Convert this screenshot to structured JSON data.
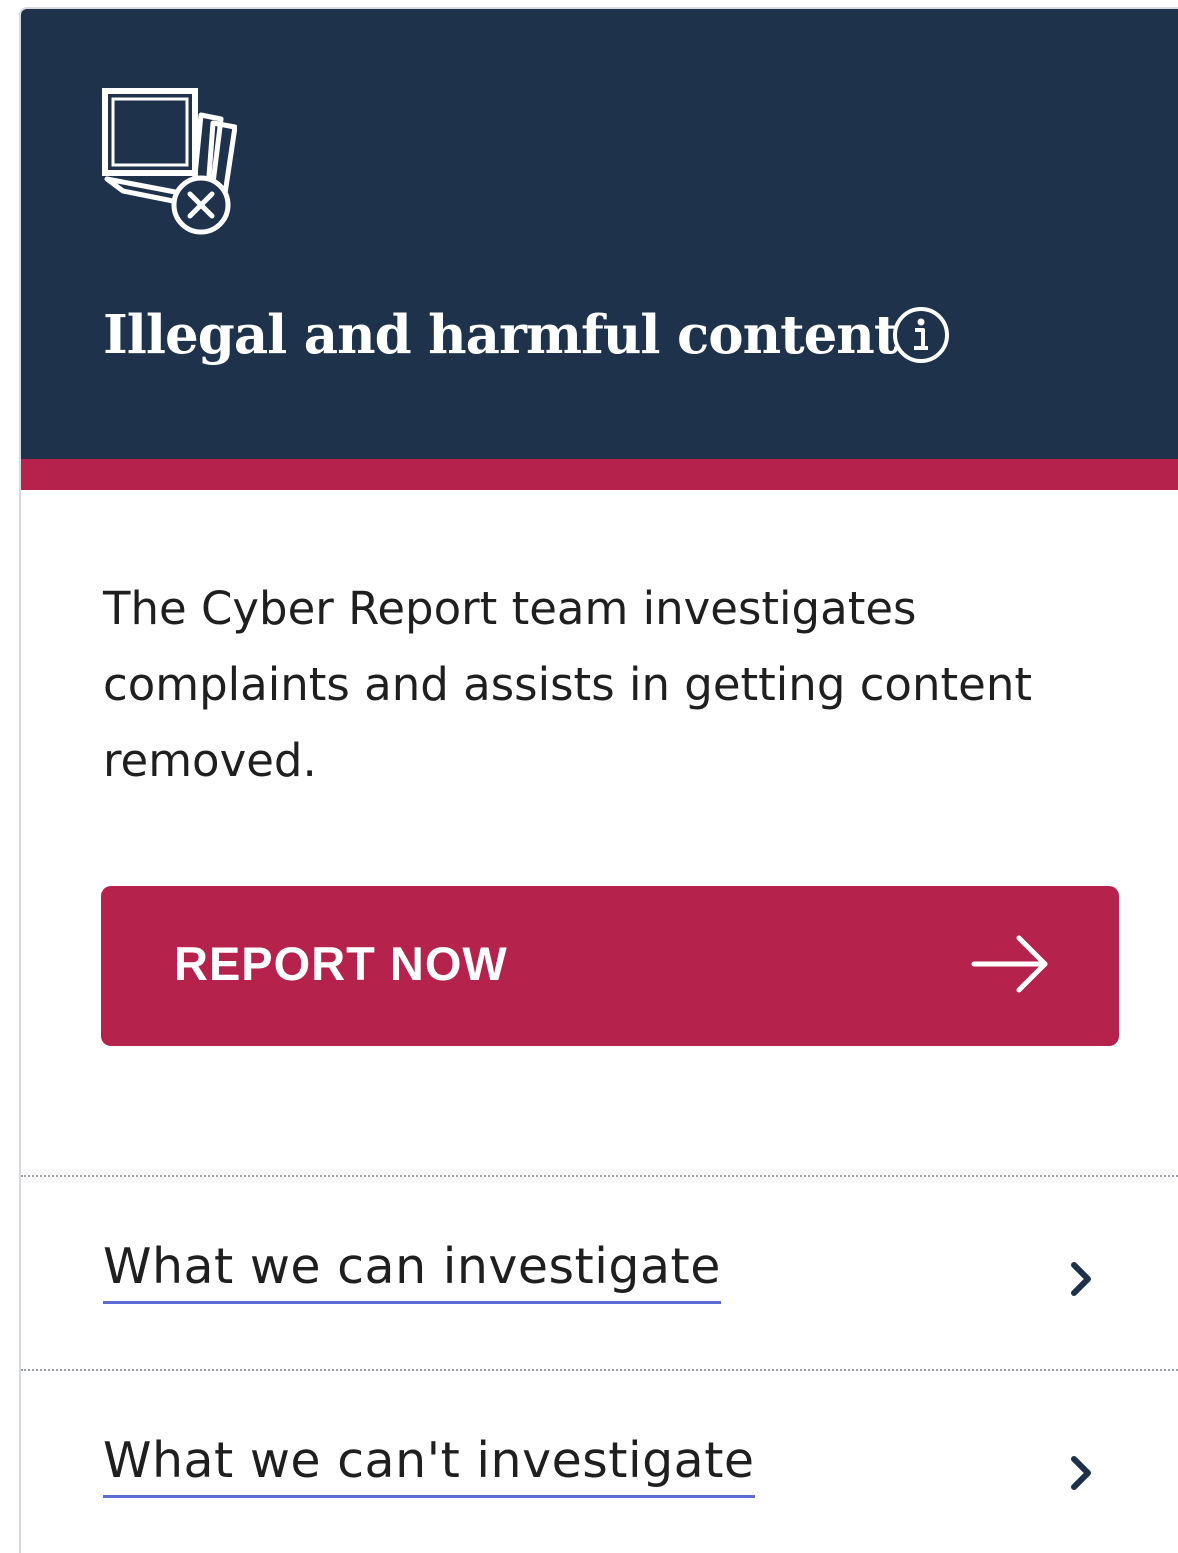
{
  "card": {
    "title": "Illegal and harmful content",
    "header_icon": "content-removal-icon",
    "info_icon": "info-icon",
    "description": "The Cyber Report team investigates complaints and assists in getting content removed.",
    "report_button": {
      "label": "REPORT NOW",
      "icon": "arrow-right-icon"
    },
    "links": [
      {
        "label": "What we can investigate",
        "icon": "chevron-right-icon"
      },
      {
        "label": "What we can't investigate",
        "icon": "chevron-right-icon"
      }
    ]
  },
  "colors": {
    "header_background": "#1e324b",
    "accent": "#b5234c",
    "link_underline": "#5b6bd6",
    "text": "#1f1f1f"
  }
}
